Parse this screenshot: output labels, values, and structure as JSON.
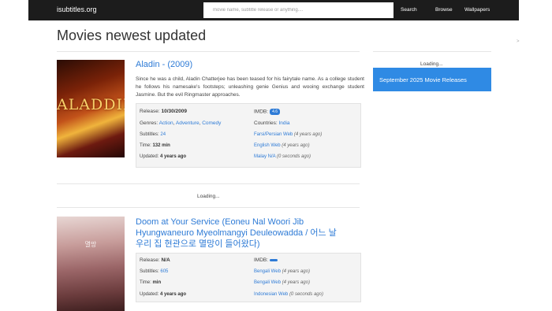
{
  "navbar": {
    "brand": "isubtitles.org",
    "search_placeholder": "movie name, subtitle release or anything....",
    "search_label": "Search",
    "browse_label": "Browse",
    "wallpapers_label": "Wallpapers"
  },
  "page": {
    "title": "Movies newest updated"
  },
  "movies": [
    {
      "title": "Aladin - (2009)",
      "poster_text": "ALADDIN",
      "plot": "Since he was a child, Aladin Chatterjee has been teased for his fairytale name. As a college student he follows his namesake's footsteps; unleashing genie Genius and wooing exchange student Jasmine. But the evil Ringmaster approaches.",
      "release_label": "Release:",
      "release": "10/30/2009",
      "imdb_label": "IMDB:",
      "imdb": "4.6",
      "genres_label": "Genres:",
      "genres": [
        "Action",
        "Adventure",
        "Comedy"
      ],
      "countries_label": "Countries:",
      "countries": [
        "India"
      ],
      "subtitles_label": "Subtitles:",
      "subtitles": "24",
      "time_label": "Time:",
      "time": "132 min",
      "updated_label": "Updated:",
      "updated": "4 years ago",
      "subs": [
        {
          "lang": "Farsi/Persian Web",
          "ago": "(4 years ago)"
        },
        {
          "lang": "English Web",
          "ago": "(4 years ago)"
        },
        {
          "lang": "Malay N/A",
          "ago": "(0 seconds ago)"
        }
      ]
    },
    {
      "title_line1": "Doom at Your Service (Eoneu Nal Woori Jib",
      "title_line2": "Hyungwaneuro Myeolmangyi Deuleowadda / 어느 날",
      "title_line3": "우리 집 현관으로 멸망이 들어왔다)",
      "poster_text": "멸망",
      "release_label": "Release:",
      "release": "N/A",
      "imdb_label": "IMDB:",
      "subtitles_label": "Subtitles:",
      "subtitles": "605",
      "time_label": "Time:",
      "time": "min",
      "updated_label": "Updated:",
      "updated": "4 years ago",
      "subs": [
        {
          "lang": "Bengali Web",
          "ago": "(4 years ago)"
        },
        {
          "lang": "Bengali Web",
          "ago": "(4 years ago)"
        },
        {
          "lang": "Indonesian Web",
          "ago": "(0 seconds ago)"
        }
      ]
    }
  ],
  "loading_text": "Loading...",
  "sidebar": {
    "loading_text": "Loading...",
    "banner": "September 2025 Movie Releases"
  },
  "scroll_hint": ">"
}
